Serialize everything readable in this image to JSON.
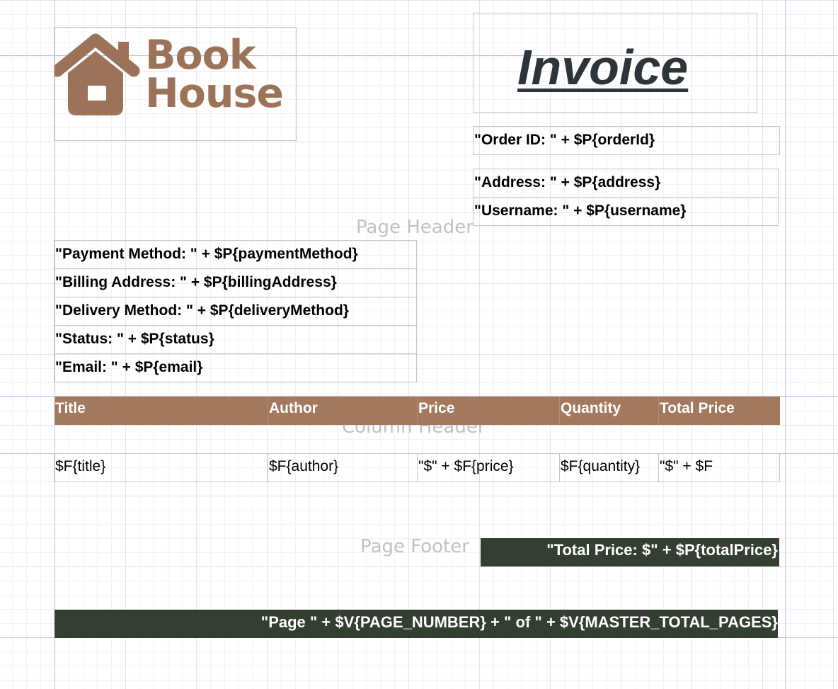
{
  "brand": {
    "name_line1": "Book",
    "name_line2": "House",
    "color": "#9c7358",
    "icon": "house-icon"
  },
  "title": "Invoice",
  "header_fields": {
    "order_id": "\"Order ID: \" + $P{orderId}",
    "address": "\"Address: \" + $P{address}",
    "username": "\"Username: \" + $P{username}"
  },
  "info_fields": [
    "\"Payment Method: \" + $P{paymentMethod}",
    "\"Billing Address: \" + $P{billingAddress}",
    "\"Delivery Method: \" + $P{deliveryMethod}",
    "\"Status: \" + $P{status}",
    "\"Email: \" + $P{email}"
  ],
  "bands": {
    "page_header": "Page Header",
    "column_header": "Column Header",
    "page_footer": "Page Footer"
  },
  "columns": [
    "Title",
    "Author",
    "Price",
    "Quantity",
    "Total Price"
  ],
  "detail_row": [
    "$F{title}",
    "$F{author}",
    "\"$\" + $F{price}",
    "$F{quantity}",
    "\"$\" + $F"
  ],
  "total_price": "\"Total Price: $\" + $P{totalPrice}",
  "page_counter": "\"Page \" + $V{PAGE_NUMBER} + \" of \" + $V{MASTER_TOTAL_PAGES}",
  "colors": {
    "header_fill": "#a3795e",
    "footer_fill": "#333f30",
    "title_color": "#2e353a",
    "guide_line": "#c3c3ea"
  }
}
